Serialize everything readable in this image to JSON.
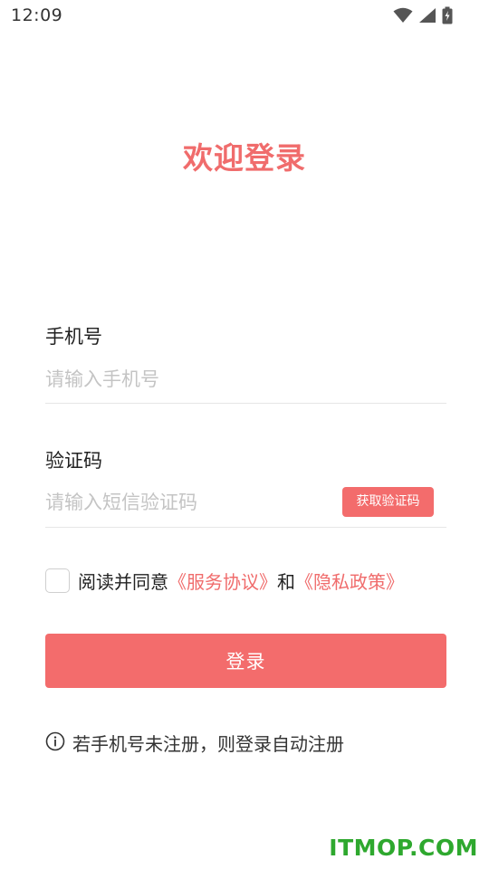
{
  "status_bar": {
    "time": "12:09",
    "icons": [
      "wifi-icon",
      "cell-signal-icon",
      "battery-charging-icon"
    ]
  },
  "header": {
    "title": "欢迎登录"
  },
  "form": {
    "phone": {
      "label": "手机号",
      "placeholder": "请输入手机号",
      "value": ""
    },
    "code": {
      "label": "验证码",
      "placeholder": "请输入短信验证码",
      "value": "",
      "get_code_label": "获取验证码"
    },
    "agreement": {
      "checked": false,
      "prefix": "阅读并同意",
      "service_link": "《服务协议》",
      "connector": "和",
      "privacy_link": "《隐私政策》"
    },
    "login_label": "登录",
    "hint": {
      "icon": "info-circle-icon",
      "text": "若手机号未注册，则登录自动注册"
    }
  },
  "watermark": "ITMOP.COM",
  "colors": {
    "accent": "#f36c6c",
    "title": "#f06c6c",
    "placeholder": "#c4c4c4",
    "divider": "#e6e6e6",
    "watermark": "#2ea82e"
  }
}
